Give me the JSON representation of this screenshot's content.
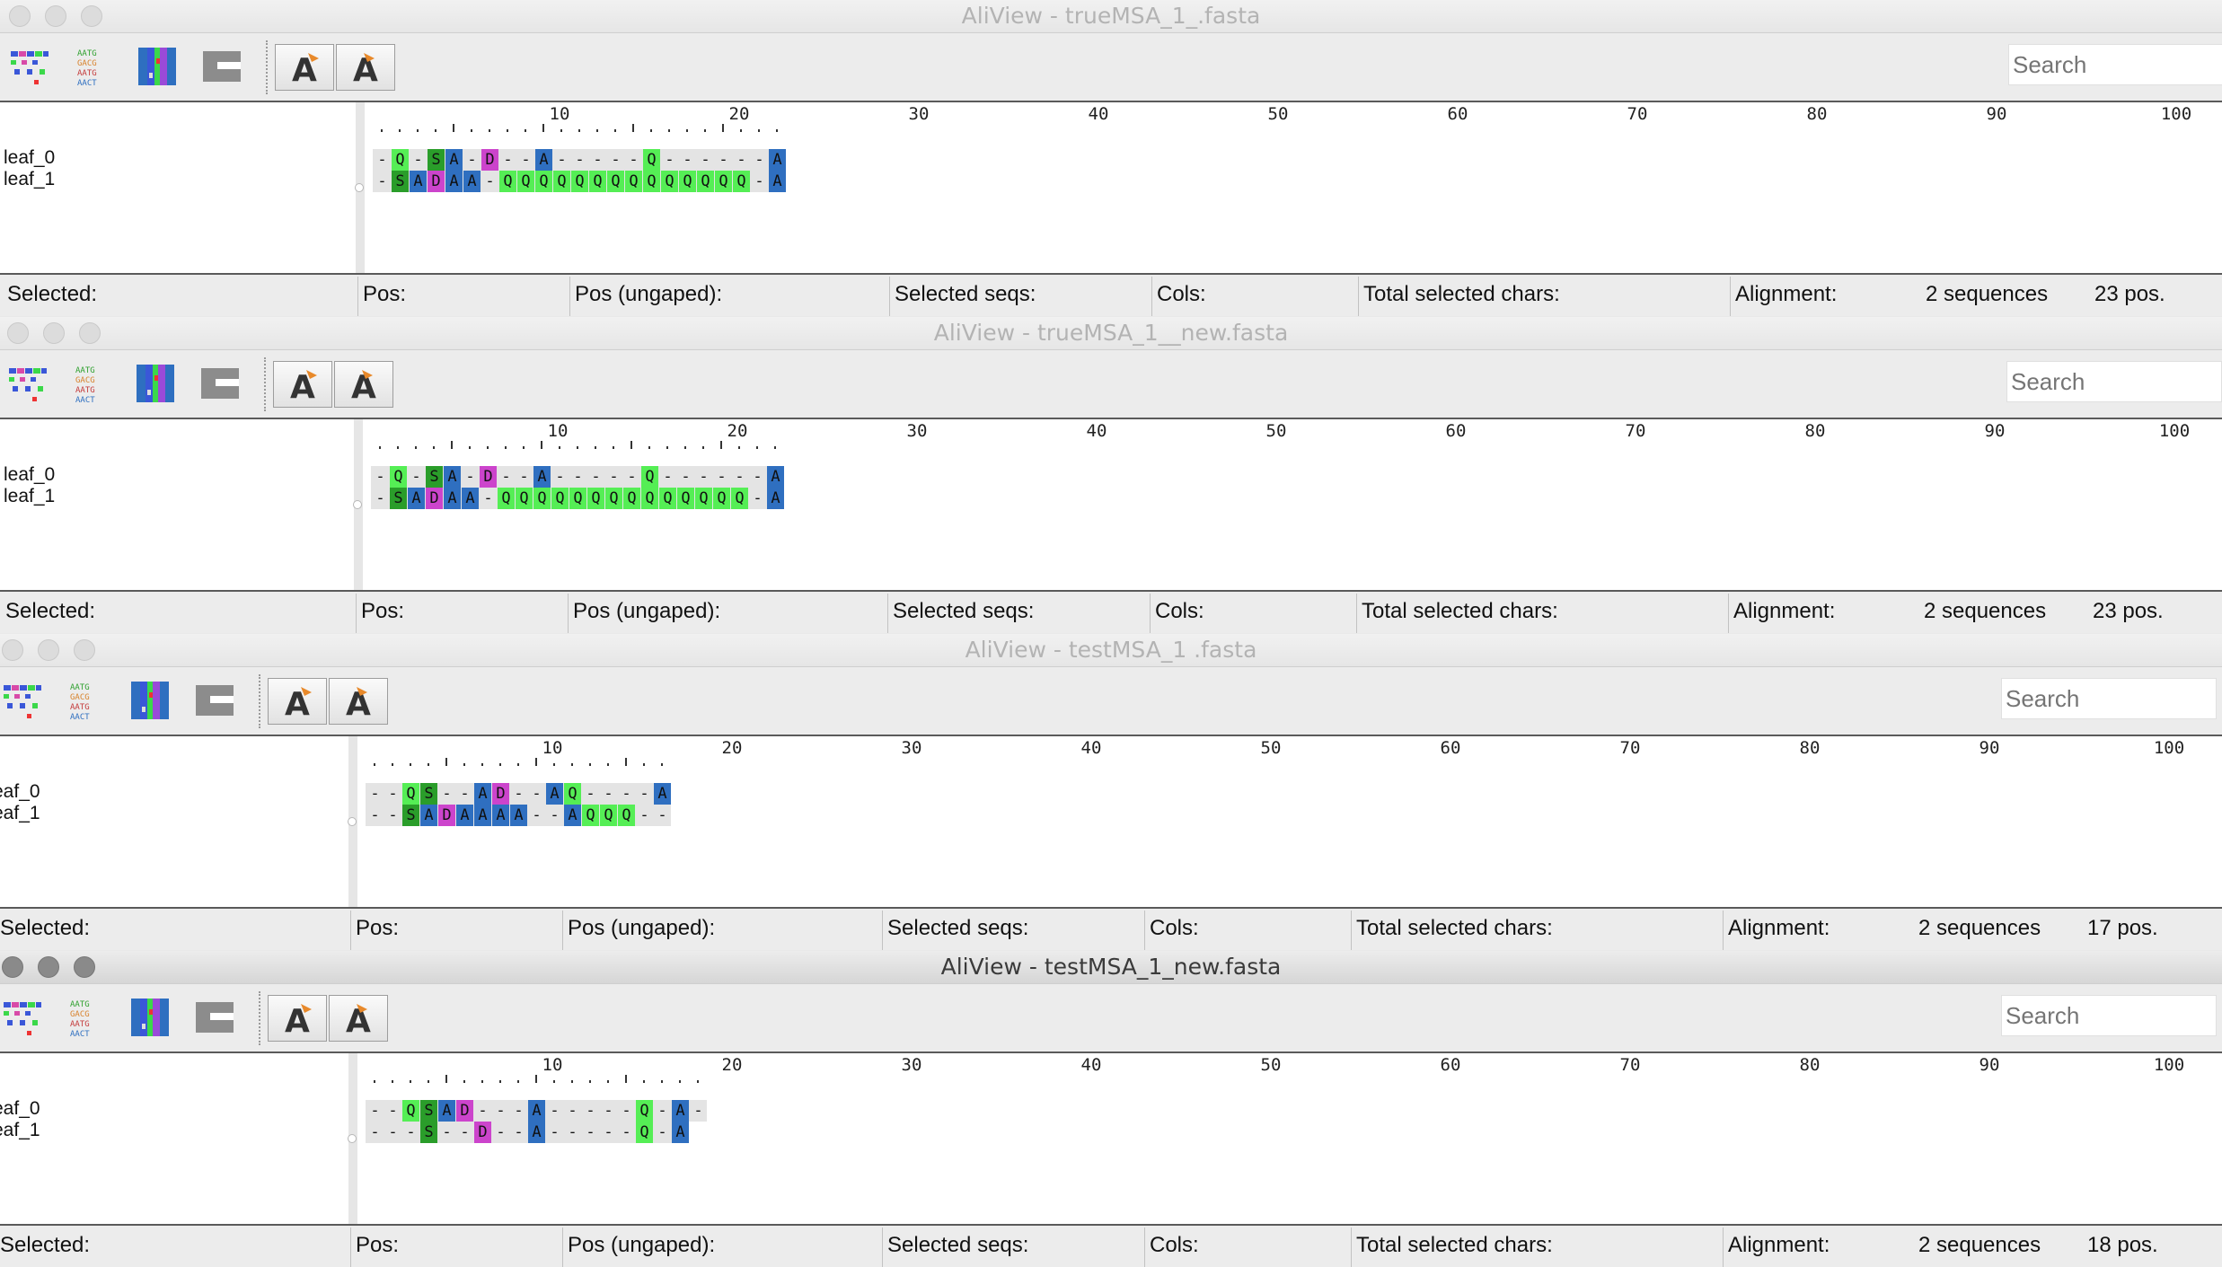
{
  "windows": [
    {
      "title": "AliView - trueMSA_1_.fasta",
      "active": false,
      "search_placeholder": "Search",
      "ruler_labels": [
        "10",
        "20",
        "30",
        "40",
        "50",
        "60",
        "70",
        "80",
        "90",
        "100"
      ],
      "sequences": [
        {
          "name": "leaf_0",
          "residues": "-Q-SA-D--A-----Q------A"
        },
        {
          "name": "leaf_1",
          "residues": "-SADAA-QQQQQQQQQQQQQQ-A"
        }
      ],
      "status": {
        "selected": "Selected:",
        "pos": "Pos:",
        "pos_ungaped": "Pos (ungaped):",
        "selected_seqs": "Selected seqs:",
        "cols": "Cols:",
        "total_selected_chars": "Total selected chars:",
        "alignment": "Alignment:",
        "seq_count": "2 sequences",
        "pos_count": "23 pos."
      }
    },
    {
      "title": "AliView - trueMSA_1__new.fasta",
      "active": false,
      "search_placeholder": "Search",
      "ruler_labels": [
        "10",
        "20",
        "30",
        "40",
        "50",
        "60",
        "70",
        "80",
        "90",
        "100"
      ],
      "sequences": [
        {
          "name": "leaf_0",
          "residues": "-Q-SA-D--A-----Q------A"
        },
        {
          "name": "leaf_1",
          "residues": "-SADAA-QQQQQQQQQQQQQQ-A"
        }
      ],
      "status": {
        "selected": "Selected:",
        "pos": "Pos:",
        "pos_ungaped": "Pos (ungaped):",
        "selected_seqs": "Selected seqs:",
        "cols": "Cols:",
        "total_selected_chars": "Total selected chars:",
        "alignment": "Alignment:",
        "seq_count": "2 sequences",
        "pos_count": "23 pos."
      }
    },
    {
      "title": "AliView - testMSA_1 .fasta",
      "active": false,
      "search_placeholder": "Search",
      "ruler_labels": [
        "10",
        "20",
        "30",
        "40",
        "50",
        "60",
        "70",
        "80",
        "90",
        "100"
      ],
      "sequences": [
        {
          "name": "eaf_0",
          "residues": "--QS--AD--AQ----A"
        },
        {
          "name": "eaf_1",
          "residues": "--SADAAAA--AQQQ--"
        }
      ],
      "status": {
        "selected": "Selected:",
        "pos": "Pos:",
        "pos_ungaped": "Pos (ungaped):",
        "selected_seqs": "Selected seqs:",
        "cols": "Cols:",
        "total_selected_chars": "Total selected chars:",
        "alignment": "Alignment:",
        "seq_count": "2 sequences",
        "pos_count": "17 pos."
      }
    },
    {
      "title": "AliView - testMSA_1_new.fasta",
      "active": true,
      "search_placeholder": "Search",
      "ruler_labels": [
        "10",
        "20",
        "30",
        "40",
        "50",
        "60",
        "70",
        "80",
        "90",
        "100"
      ],
      "sequences": [
        {
          "name": "eaf_0",
          "residues": "--QSAD---A-----Q-A-"
        },
        {
          "name": "eaf_1",
          "residues": "---S--D--A-----Q-A"
        }
      ],
      "status": {
        "selected": "Selected:",
        "pos": "Pos:",
        "pos_ungaped": "Pos (ungaped):",
        "selected_seqs": "Selected seqs:",
        "cols": "Cols:",
        "total_selected_chars": "Total selected chars:",
        "alignment": "Alignment:",
        "seq_count": "2 sequences",
        "pos_count": "18 pos."
      }
    }
  ],
  "residue_colors": {
    "S": "#2a9d2a",
    "A": "#2f6fc0",
    "D": "#cc44cc",
    "Q": "#55ee55",
    "-": "#e4e4e4"
  },
  "toolbar_icons": [
    "translation-view-icon",
    "nucleotide-view-icon",
    "color-scheme-icon",
    "gap-toggle-icon",
    "font-decrease-icon",
    "font-increase-icon"
  ]
}
